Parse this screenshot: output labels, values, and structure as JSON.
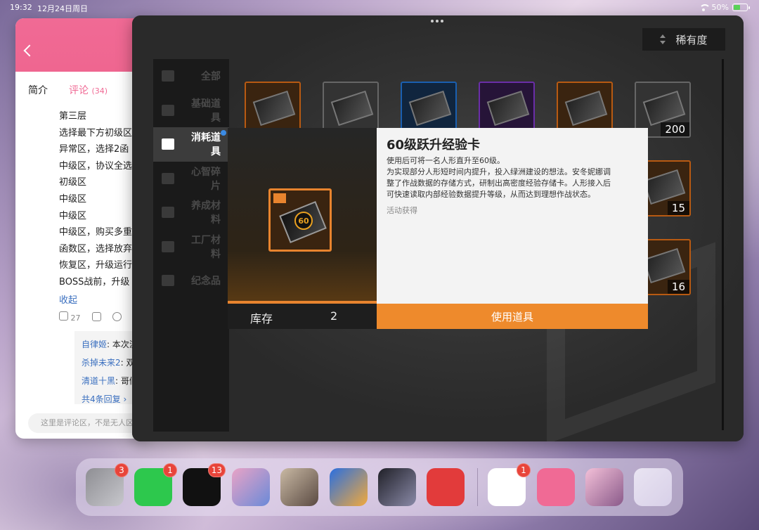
{
  "status_bar": {
    "time": "19:32",
    "date": "12月24日周日",
    "battery": "50%",
    "battery_level": 0.5
  },
  "bili_window": {
    "tabs": {
      "intro": "简介",
      "comments": "评论",
      "comments_count": "(34)"
    },
    "comment_lines": [
      "第三层",
      "选择最下方初级区",
      "异常区，选择2函",
      "中级区，协议全选",
      "初级区",
      "中级区",
      "中级区",
      "中级区，购买多重",
      "函数区，选择放弃",
      "恢复区，升级运行",
      "BOSS战前，升级"
    ],
    "collapse": "收起",
    "likes": "27",
    "replies": [
      {
        "author": "自律姬",
        "text": ": 本次流程"
      },
      {
        "author": "杀掉未来2",
        "text": ": 双重"
      },
      {
        "author": "清道十黑",
        "text": ": 哥们用"
      }
    ],
    "more_replies": "共4条回复 ›",
    "input_placeholder": "这里是评论区，不是无人区"
  },
  "game_window": {
    "rarity_label": "稀有度",
    "categories": [
      {
        "label": "全部",
        "icon": "grid-icon"
      },
      {
        "label": "基础道具",
        "icon": "layers-icon"
      },
      {
        "label": "消耗道具",
        "icon": "cube-icon"
      },
      {
        "label": "心智碎片",
        "icon": "puzzle-icon"
      },
      {
        "label": "养成材料",
        "icon": "figure-icon"
      },
      {
        "label": "工厂材料",
        "icon": "gear-icon"
      },
      {
        "label": "纪念品",
        "icon": "trophy-icon"
      }
    ],
    "active_category": 2,
    "item_counts": {
      "slot_6": "200",
      "slot_12": "15",
      "slot_18": "16"
    },
    "detail": {
      "title": "60级跃升经验卡",
      "icon_label": "60",
      "description_lines": [
        "使用后可将一名人形直升至60级。",
        "为实现部分人形短时间内提升，投入绿洲建设的想法。安冬妮娜调",
        "整了作战数据的存储方式，研制出高密度经验存储卡。人形接入后",
        "可快速读取内部经验数据提升等级，从而达到理想作战状态。"
      ],
      "source": "活动获得",
      "stock_label": "库存",
      "stock_value": "2",
      "use_button": "使用道具"
    }
  },
  "dock": {
    "apps": [
      {
        "name": "settings",
        "badge": "3",
        "colors": [
          "#8e8e93",
          "#c7c7cc"
        ]
      },
      {
        "name": "wechat",
        "badge": "1",
        "colors": [
          "#2dc84d",
          "#2dc84d"
        ]
      },
      {
        "name": "tiktok",
        "badge": "13",
        "colors": [
          "#111111",
          "#111111"
        ]
      },
      {
        "name": "anime-game-1",
        "badge": "",
        "colors": [
          "#e9a3c6",
          "#6a8ad8"
        ]
      },
      {
        "name": "girls-frontline",
        "badge": "",
        "colors": [
          "#c9b9a4",
          "#5a4a42"
        ]
      },
      {
        "name": "penguin-game",
        "badge": "",
        "colors": [
          "#2a6fe0",
          "#f2a93b"
        ]
      },
      {
        "name": "dark-portrait-game",
        "badge": "",
        "colors": [
          "#202028",
          "#8a8aa8"
        ]
      },
      {
        "name": "netease-music",
        "badge": "",
        "colors": [
          "#e23b3b",
          "#e23b3b"
        ]
      },
      {
        "name": "qq",
        "badge": "1",
        "colors": [
          "#ffffff",
          "#ffffff"
        ]
      },
      {
        "name": "bilibili",
        "badge": "",
        "colors": [
          "#f06a95",
          "#f06a95"
        ]
      },
      {
        "name": "anime-girl-app",
        "badge": "",
        "colors": [
          "#f3c0d8",
          "#8a5a8a"
        ]
      },
      {
        "name": "app-library",
        "badge": "",
        "colors": [
          "#e9e4f2",
          "#d8d0e8"
        ]
      }
    ]
  }
}
